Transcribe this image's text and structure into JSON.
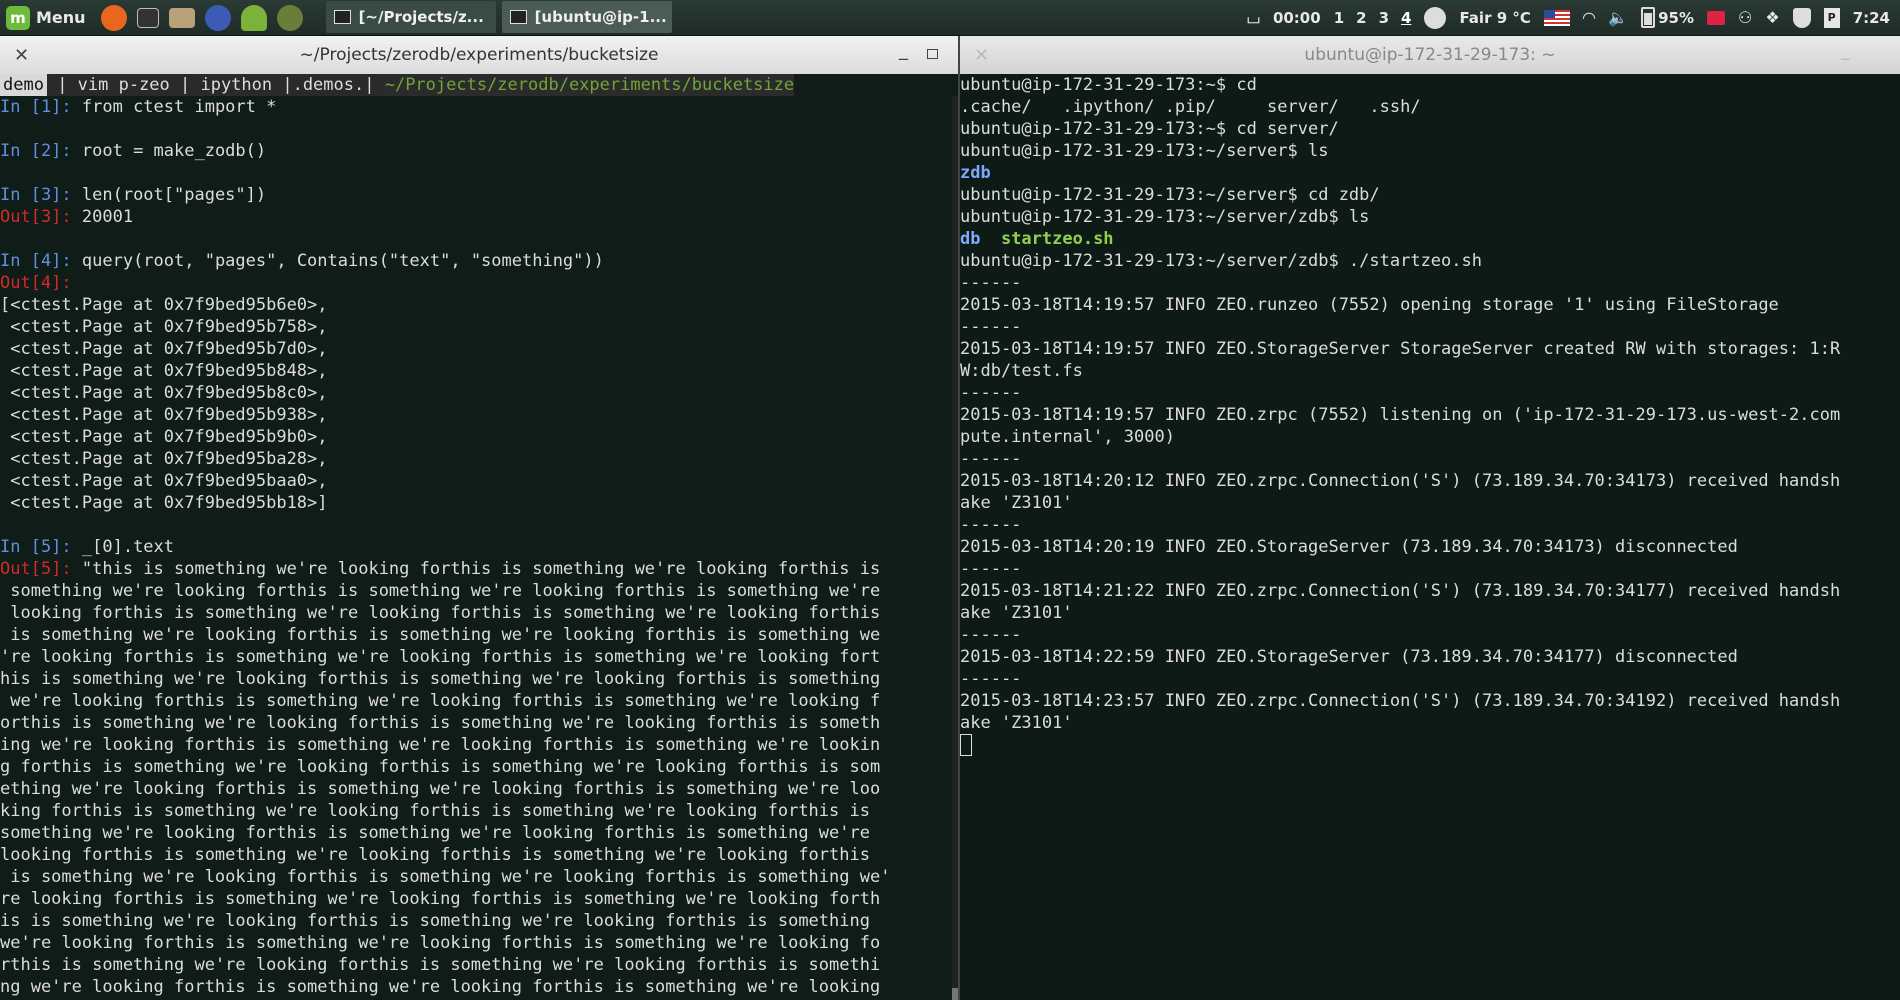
{
  "panel": {
    "menu_label": "Menu",
    "tasks": [
      {
        "label": "[~/Projects/z..."
      },
      {
        "label": "[ubuntu@ip-1..."
      }
    ],
    "clock_elapsed": "00:00",
    "workspaces": [
      "1",
      "2",
      "3",
      "4"
    ],
    "weather": "Fair 9 °C",
    "battery": "95%",
    "time": "7:24"
  },
  "left_window": {
    "title": "~/Projects/zerodb/experiments/bucketsize",
    "tmux": {
      "tab_current": "demo",
      "tabs_rest": " | vim p-zeo | ipython |.demos.| ",
      "path": "~/Projects/zerodb/experiments/bucketsize"
    },
    "lines": [
      {
        "p": "In [1]: ",
        "k": "in",
        "t": "from ctest import *"
      },
      {
        "p": "",
        "k": "",
        "t": ""
      },
      {
        "p": "In [2]: ",
        "k": "in",
        "t": "root = make_zodb()"
      },
      {
        "p": "",
        "k": "",
        "t": ""
      },
      {
        "p": "In [3]: ",
        "k": "in",
        "t": "len(root[\"pages\"])"
      },
      {
        "p": "Out[3]: ",
        "k": "out",
        "t": "20001"
      },
      {
        "p": "",
        "k": "",
        "t": ""
      },
      {
        "p": "In [4]: ",
        "k": "in",
        "t": "query(root, \"pages\", Contains(\"text\", \"something\"))"
      },
      {
        "p": "Out[4]: ",
        "k": "out",
        "t": ""
      },
      {
        "p": "",
        "k": "",
        "t": "[<ctest.Page at 0x7f9bed95b6e0>,"
      },
      {
        "p": "",
        "k": "",
        "t": " <ctest.Page at 0x7f9bed95b758>,"
      },
      {
        "p": "",
        "k": "",
        "t": " <ctest.Page at 0x7f9bed95b7d0>,"
      },
      {
        "p": "",
        "k": "",
        "t": " <ctest.Page at 0x7f9bed95b848>,"
      },
      {
        "p": "",
        "k": "",
        "t": " <ctest.Page at 0x7f9bed95b8c0>,"
      },
      {
        "p": "",
        "k": "",
        "t": " <ctest.Page at 0x7f9bed95b938>,"
      },
      {
        "p": "",
        "k": "",
        "t": " <ctest.Page at 0x7f9bed95b9b0>,"
      },
      {
        "p": "",
        "k": "",
        "t": " <ctest.Page at 0x7f9bed95ba28>,"
      },
      {
        "p": "",
        "k": "",
        "t": " <ctest.Page at 0x7f9bed95baa0>,"
      },
      {
        "p": "",
        "k": "",
        "t": " <ctest.Page at 0x7f9bed95bb18>]"
      },
      {
        "p": "",
        "k": "",
        "t": ""
      },
      {
        "p": "In [5]: ",
        "k": "in",
        "t": "_[0].text"
      },
      {
        "p": "Out[5]: ",
        "k": "out",
        "t": "\"this is something we're looking forthis is something we're looking forthis is"
      },
      {
        "p": "",
        "k": "",
        "t": " something we're looking forthis is something we're looking forthis is something we're"
      },
      {
        "p": "",
        "k": "",
        "t": " looking forthis is something we're looking forthis is something we're looking forthis"
      },
      {
        "p": "",
        "k": "",
        "t": " is something we're looking forthis is something we're looking forthis is something we"
      },
      {
        "p": "",
        "k": "",
        "t": "'re looking forthis is something we're looking forthis is something we're looking fort"
      },
      {
        "p": "",
        "k": "",
        "t": "his is something we're looking forthis is something we're looking forthis is something"
      },
      {
        "p": "",
        "k": "",
        "t": " we're looking forthis is something we're looking forthis is something we're looking f"
      },
      {
        "p": "",
        "k": "",
        "t": "orthis is something we're looking forthis is something we're looking forthis is someth"
      },
      {
        "p": "",
        "k": "",
        "t": "ing we're looking forthis is something we're looking forthis is something we're lookin"
      },
      {
        "p": "",
        "k": "",
        "t": "g forthis is something we're looking forthis is something we're looking forthis is som"
      },
      {
        "p": "",
        "k": "",
        "t": "ething we're looking forthis is something we're looking forthis is something we're loo"
      },
      {
        "p": "",
        "k": "",
        "t": "king forthis is something we're looking forthis is something we're looking forthis is"
      },
      {
        "p": "",
        "k": "",
        "t": "something we're looking forthis is something we're looking forthis is something we're"
      },
      {
        "p": "",
        "k": "",
        "t": "looking forthis is something we're looking forthis is something we're looking forthis"
      },
      {
        "p": "",
        "k": "",
        "t": " is something we're looking forthis is something we're looking forthis is something we'"
      },
      {
        "p": "",
        "k": "",
        "t": "re looking forthis is something we're looking forthis is something we're looking forth"
      },
      {
        "p": "",
        "k": "",
        "t": "is is something we're looking forthis is something we're looking forthis is something"
      },
      {
        "p": "",
        "k": "",
        "t": "we're looking forthis is something we're looking forthis is something we're looking fo"
      },
      {
        "p": "",
        "k": "",
        "t": "rthis is something we're looking forthis is something we're looking forthis is somethi"
      },
      {
        "p": "",
        "k": "",
        "t": "ng we're looking forthis is something we're looking forthis is something we're looking"
      }
    ]
  },
  "right_window": {
    "title": "ubuntu@ip-172-31-29-173: ~",
    "lines": [
      {
        "k": "",
        "t": "ubuntu@ip-172-31-29-173:~$ cd"
      },
      {
        "k": "",
        "t": ".cache/   .ipython/ .pip/     server/   .ssh/"
      },
      {
        "k": "",
        "t": "ubuntu@ip-172-31-29-173:~$ cd server/"
      },
      {
        "k": "",
        "t": "ubuntu@ip-172-31-29-173:~/server$ ls"
      },
      {
        "k": "blue",
        "t": "zdb"
      },
      {
        "k": "",
        "t": "ubuntu@ip-172-31-29-173:~/server$ cd zdb/"
      },
      {
        "k": "",
        "t": "ubuntu@ip-172-31-29-173:~/server/zdb$ ls"
      },
      {
        "k": "dbls",
        "t": "db",
        "t2": "startzeo.sh"
      },
      {
        "k": "",
        "t": "ubuntu@ip-172-31-29-173:~/server/zdb$ ./startzeo.sh"
      },
      {
        "k": "",
        "t": "------"
      },
      {
        "k": "",
        "t": "2015-03-18T14:19:57 INFO ZEO.runzeo (7552) opening storage '1' using FileStorage"
      },
      {
        "k": "",
        "t": "------"
      },
      {
        "k": "",
        "t": "2015-03-18T14:19:57 INFO ZEO.StorageServer StorageServer created RW with storages: 1:R"
      },
      {
        "k": "",
        "t": "W:db/test.fs"
      },
      {
        "k": "",
        "t": "------"
      },
      {
        "k": "",
        "t": "2015-03-18T14:19:57 INFO ZEO.zrpc (7552) listening on ('ip-172-31-29-173.us-west-2.com"
      },
      {
        "k": "",
        "t": "pute.internal', 3000)"
      },
      {
        "k": "",
        "t": "------"
      },
      {
        "k": "",
        "t": "2015-03-18T14:20:12 INFO ZEO.zrpc.Connection('S') (73.189.34.70:34173) received handsh"
      },
      {
        "k": "",
        "t": "ake 'Z3101'"
      },
      {
        "k": "",
        "t": "------"
      },
      {
        "k": "",
        "t": "2015-03-18T14:20:19 INFO ZEO.StorageServer (73.189.34.70:34173) disconnected"
      },
      {
        "k": "",
        "t": "------"
      },
      {
        "k": "",
        "t": "2015-03-18T14:21:22 INFO ZEO.zrpc.Connection('S') (73.189.34.70:34177) received handsh"
      },
      {
        "k": "",
        "t": "ake 'Z3101'"
      },
      {
        "k": "",
        "t": "------"
      },
      {
        "k": "",
        "t": "2015-03-18T14:22:59 INFO ZEO.StorageServer (73.189.34.70:34177) disconnected"
      },
      {
        "k": "",
        "t": "------"
      },
      {
        "k": "",
        "t": "2015-03-18T14:23:57 INFO ZEO.zrpc.Connection('S') (73.189.34.70:34192) received handsh"
      },
      {
        "k": "",
        "t": "ake 'Z3101'"
      }
    ]
  }
}
